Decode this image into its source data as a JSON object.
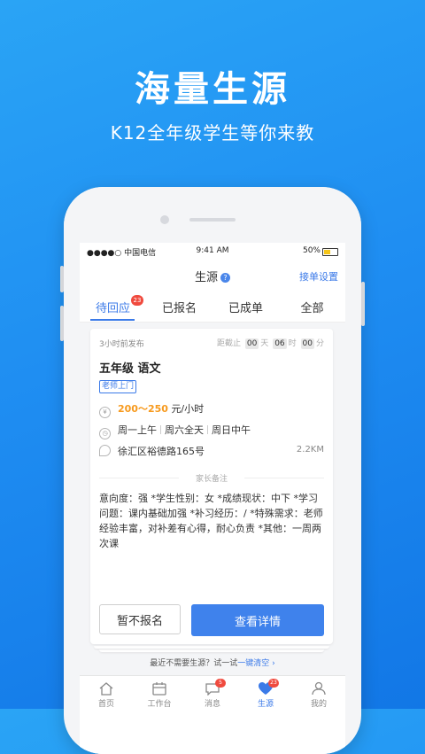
{
  "hero": {
    "title": "海量生源",
    "subtitle": "K12全年级学生等你来教"
  },
  "statusbar": {
    "carrier": "●●●●○ 中国电信",
    "time": "9:41 AM",
    "battery": "50%",
    "battery_level": 0.5
  },
  "navbar": {
    "title": "生源",
    "help_glyph": "?",
    "action": "接单设置"
  },
  "tabs": [
    {
      "label": "待回应",
      "badge": "23"
    },
    {
      "label": "已报名"
    },
    {
      "label": "已成单"
    },
    {
      "label": "全部"
    }
  ],
  "card": {
    "posted": "3小时前发布",
    "countdown": {
      "prefix": "距截止",
      "days": "00",
      "days_unit": "天",
      "hours": "06",
      "hours_unit": "时",
      "minutes": "00",
      "minutes_unit": "分"
    },
    "subject": "五年级 语文",
    "tag": "老师上门",
    "price_value": "200～250",
    "price_unit": "元/小时",
    "schedule": [
      "周一上午",
      "周六全天",
      "周日中午"
    ],
    "address": "徐汇区裕德路165号",
    "distance": "2.2KM",
    "notes_label": "家长备注",
    "notes": "意向度：强 *学生性别：女 *成绩现状：中下 *学习问题：课内基础加强 *补习经历：/ *特殊需求：老师经验丰富，对补差有心得，耐心负责 *其他：一周两次课",
    "decline_label": "暂不报名",
    "detail_label": "查看详情"
  },
  "hint": {
    "text": "最近不需要生源？试一试",
    "link": "一键清空",
    "arrow": "›"
  },
  "bottom_nav": [
    {
      "label": "首页",
      "icon": "home-icon"
    },
    {
      "label": "工作台",
      "icon": "calendar-icon"
    },
    {
      "label": "消息",
      "icon": "message-icon",
      "badge": "5"
    },
    {
      "label": "生源",
      "icon": "heart-icon",
      "badge": "23",
      "active": true
    },
    {
      "label": "我的",
      "icon": "user-icon"
    }
  ],
  "colors": {
    "accent": "#3b7ae8",
    "price": "#f79a1e",
    "badge": "#f04a3e",
    "background": "#1f8ef2"
  }
}
